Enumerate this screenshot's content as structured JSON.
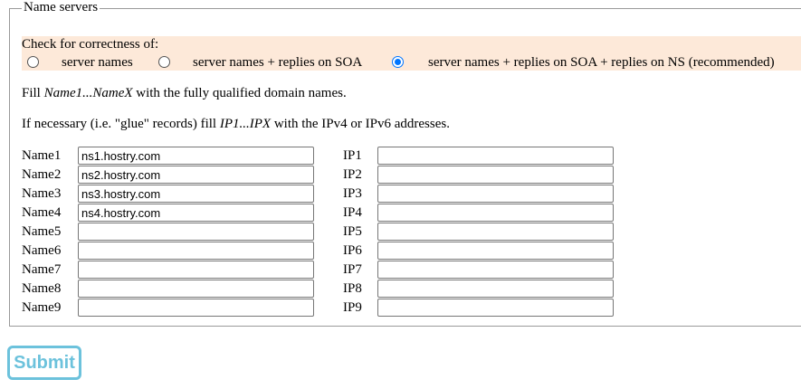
{
  "legend": "Name servers",
  "check": {
    "title": "Check for correctness of:",
    "options": [
      {
        "label": "server names",
        "checked": false
      },
      {
        "label": "server names + replies on SOA",
        "checked": false
      },
      {
        "label": "server names + replies on SOA + replies on NS (recommended)",
        "checked": true
      }
    ]
  },
  "fill_line": {
    "pre": "Fill ",
    "em": "Name1...NameX",
    "post": " with the fully qualified domain names."
  },
  "glue_line": {
    "pre": "If necessary (i.e. \"glue\" records) fill ",
    "em": "IP1...IPX",
    "post": " with the IPv4 or IPv6 addresses."
  },
  "rows": [
    {
      "name_label": "Name1",
      "name_value": "ns1.hostry.com",
      "ip_label": "IP1",
      "ip_value": ""
    },
    {
      "name_label": "Name2",
      "name_value": "ns2.hostry.com",
      "ip_label": "IP2",
      "ip_value": ""
    },
    {
      "name_label": "Name3",
      "name_value": "ns3.hostry.com",
      "ip_label": "IP3",
      "ip_value": ""
    },
    {
      "name_label": "Name4",
      "name_value": "ns4.hostry.com",
      "ip_label": "IP4",
      "ip_value": ""
    },
    {
      "name_label": "Name5",
      "name_value": "",
      "ip_label": "IP5",
      "ip_value": ""
    },
    {
      "name_label": "Name6",
      "name_value": "",
      "ip_label": "IP6",
      "ip_value": ""
    },
    {
      "name_label": "Name7",
      "name_value": "",
      "ip_label": "IP7",
      "ip_value": ""
    },
    {
      "name_label": "Name8",
      "name_value": "",
      "ip_label": "IP8",
      "ip_value": ""
    },
    {
      "name_label": "Name9",
      "name_value": "",
      "ip_label": "IP9",
      "ip_value": ""
    }
  ],
  "submit_label": "Submit",
  "colors": {
    "check_bg": "#fde9d9",
    "submit": "#6cc2dc",
    "radio_checked": "#0075ff"
  }
}
